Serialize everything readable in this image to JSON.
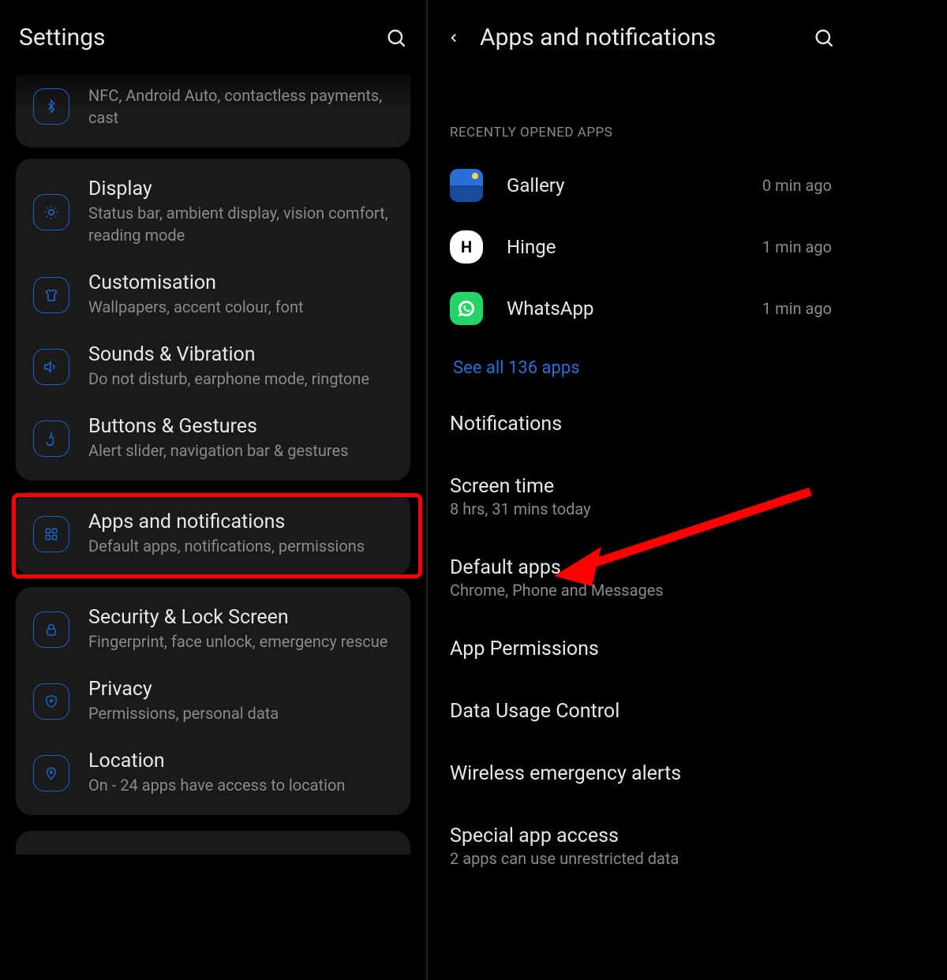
{
  "left": {
    "title": "Settings",
    "cut_row_sub": "NFC, Android Auto, contactless payments, cast",
    "groups": [
      {
        "rows": [
          {
            "title": "Display",
            "sub": "Status bar, ambient display, vision comfort, reading mode",
            "icon": "brightness"
          },
          {
            "title": "Customisation",
            "sub": "Wallpapers, accent colour, font",
            "icon": "shirt"
          },
          {
            "title": "Sounds & Vibration",
            "sub": "Do not disturb, earphone mode, ringtone",
            "icon": "speaker"
          },
          {
            "title": "Buttons & Gestures",
            "sub": "Alert slider, navigation bar & gestures",
            "icon": "gesture"
          }
        ]
      },
      {
        "rows": [
          {
            "title": "Apps and notifications",
            "sub": "Default apps, notifications, permissions",
            "icon": "grid",
            "highlighted": true
          }
        ]
      },
      {
        "rows": [
          {
            "title": "Security & Lock Screen",
            "sub": "Fingerprint, face unlock, emergency rescue",
            "icon": "lock"
          },
          {
            "title": "Privacy",
            "sub": "Permissions, personal data",
            "icon": "shield"
          },
          {
            "title": "Location",
            "sub": "On - 24 apps have access to location",
            "icon": "pin"
          }
        ]
      }
    ]
  },
  "right": {
    "title": "Apps and notifications",
    "recent_label": "RECENTLY OPENED APPS",
    "apps": [
      {
        "name": "Gallery",
        "time": "0 min ago",
        "iconType": "gallery"
      },
      {
        "name": "Hinge",
        "time": "1 min ago",
        "iconType": "hinge"
      },
      {
        "name": "WhatsApp",
        "time": "1 min ago",
        "iconType": "whatsapp"
      }
    ],
    "see_all": "See all 136 apps",
    "rows": [
      {
        "title": "Notifications",
        "sub": ""
      },
      {
        "title": "Screen time",
        "sub": "8 hrs, 31 mins today"
      },
      {
        "title": "Default apps",
        "sub": "Chrome, Phone and Messages",
        "arrow_target": true
      },
      {
        "title": "App Permissions",
        "sub": ""
      },
      {
        "title": "Data Usage Control",
        "sub": ""
      },
      {
        "title": "Wireless emergency alerts",
        "sub": ""
      },
      {
        "title": "Special app access",
        "sub": "2 apps can use unrestricted data"
      }
    ]
  },
  "annotations": {
    "highlight_color": "#ff0000",
    "arrow_color": "#ff0000"
  }
}
